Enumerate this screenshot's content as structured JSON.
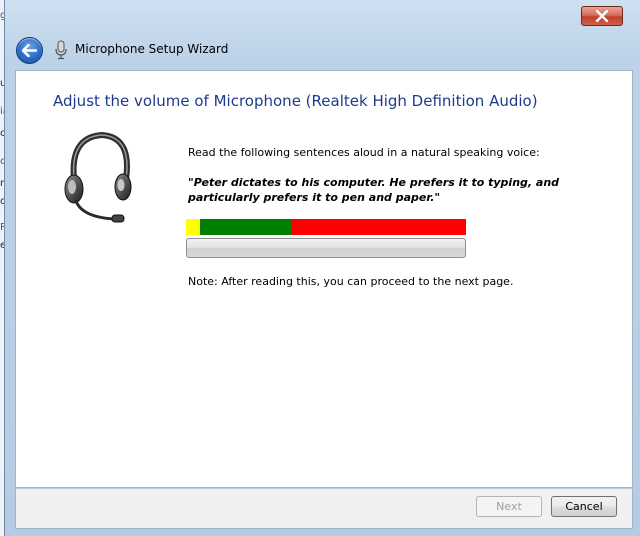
{
  "background_window": {
    "fragments": [
      "gr",
      "ut",
      "ia",
      "co",
      "ce",
      "ro",
      "ct",
      "Re",
      "et"
    ]
  },
  "window": {
    "title": "Microphone Setup Wizard",
    "close_icon": "close-icon",
    "back_icon": "back-arrow-icon",
    "title_icon": "microphone-icon"
  },
  "page": {
    "heading": "Adjust the volume of Microphone (Realtek High Definition Audio)",
    "instruction": "Read the following sentences aloud in a natural speaking voice:",
    "quote": "\"Peter dictates to his computer. He prefers it to typing, and particularly prefers it to pen and paper.\"",
    "note": "Note: After reading this, you can proceed to the next page.",
    "illustration": "headset-icon"
  },
  "volume_meter": {
    "segments": [
      {
        "name": "low",
        "color": "#ffff00",
        "fraction": 0.05
      },
      {
        "name": "ok",
        "color": "#008000",
        "fraction": 0.325
      },
      {
        "name": "high",
        "color": "#ff0000",
        "fraction": 0.625
      }
    ],
    "current_level": 0
  },
  "buttons": {
    "next": "Next",
    "cancel": "Cancel"
  },
  "colors": {
    "heading": "#1e3a8c",
    "meter_yellow": "#ffff00",
    "meter_green": "#008000",
    "meter_red": "#ff0000"
  }
}
